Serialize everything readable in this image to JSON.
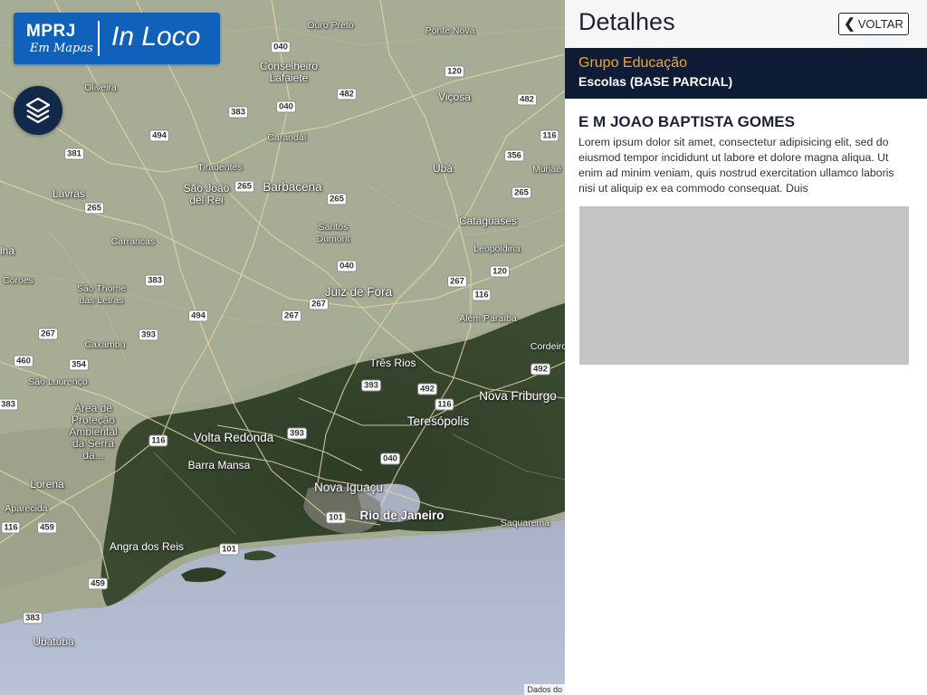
{
  "logo": {
    "brand": "MPRJ",
    "subtitle": "Em Mapas",
    "app_name": "In Loco"
  },
  "map": {
    "layers_icon": "layers-icon",
    "attribution": "Dados do",
    "places": [
      {
        "name": "Ouro Preto"
      },
      {
        "name": "Ponte Nova"
      },
      {
        "name": "Conselheiro Lafaiete"
      },
      {
        "name": "Oliveira"
      },
      {
        "name": "Viçosa"
      },
      {
        "name": "Carandaí"
      },
      {
        "name": "Ubá"
      },
      {
        "name": "Muriaé"
      },
      {
        "name": "Tiradentes"
      },
      {
        "name": "Lavras"
      },
      {
        "name": "São João del Rei"
      },
      {
        "name": "Barbacena"
      },
      {
        "name": "Santos Dumont"
      },
      {
        "name": "Cataguases"
      },
      {
        "name": "Leopoldina"
      },
      {
        "name": "Carrancas"
      },
      {
        "name": "São Thomé das Letras"
      },
      {
        "name": "Juiz de Fora"
      },
      {
        "name": "Além Paraíba"
      },
      {
        "name": "Caxambu"
      },
      {
        "name": "Cordeiro"
      },
      {
        "name": "Três Rios"
      },
      {
        "name": "São Lourenço"
      },
      {
        "name": "Nova Friburgo"
      },
      {
        "name": "Área de Proteção Ambiental da Serra da..."
      },
      {
        "name": "Teresópolis"
      },
      {
        "name": "Volta Redonda"
      },
      {
        "name": "Barra Mansa"
      },
      {
        "name": "Lorena"
      },
      {
        "name": "Nova Iguaçu"
      },
      {
        "name": "Aparecida"
      },
      {
        "name": "Rio de Janeiro"
      },
      {
        "name": "Saquarema"
      },
      {
        "name": "Angra dos Reis"
      },
      {
        "name": "Ubatuba"
      },
      {
        "name": "Coroes"
      },
      {
        "name": "lha"
      }
    ],
    "shields": [
      "040",
      "120",
      "482",
      "383",
      "040",
      "494",
      "381",
      "116",
      "356",
      "265",
      "265",
      "265",
      "265",
      "383",
      "040",
      "120",
      "267",
      "494",
      "267",
      "116",
      "267",
      "267",
      "393",
      "460",
      "354",
      "492",
      "383",
      "393",
      "492",
      "116",
      "393",
      "116",
      "040",
      "459",
      "101",
      "116",
      "459",
      "101",
      "383",
      "482"
    ]
  },
  "panel": {
    "title": "Detalhes",
    "back_label": "VOLTAR",
    "back_icon": "chevron-left-icon",
    "group": "Grupo Educação",
    "layer": "Escolas (BASE PARCIAL)",
    "item_title": "E M JOAO BAPTISTA GOMES",
    "item_description": "Lorem ipsum dolor sit amet, consectetur adipisicing elit, sed do eiusmod tempor incididunt ut labore et dolore magna aliqua. Ut enim ad minim veniam, quis nostrud exercitation ullamco laboris nisi ut aliquip ex ea commodo consequat. Duis"
  },
  "colors": {
    "logo_blue": "#1061b9",
    "navy": "#0f1c36",
    "accent_orange": "#f3a721",
    "image_placeholder": "#c4c4c4"
  }
}
